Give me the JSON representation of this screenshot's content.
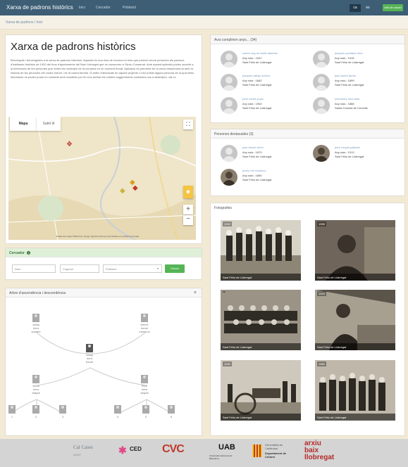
{
  "nav": {
    "brand": "Xarxa de padrons històrics",
    "links": [
      "Inici",
      "Cercador",
      "Població"
    ],
    "lang_active": "ca",
    "lang_other": "es",
    "signup": "Alta de usuari"
  },
  "breadcrumb": "Xarxa de padrons  /  Inici",
  "intro": {
    "title": "Xarxa de padrons històrics",
    "text": "Benvinguts i benvingudes a la xarxa de padrons històrics. Aquesta és una eina de recerca en línia que permet cercar persones als padrons d'habitants històrics de 1920 del fons d'ajuntaments del Baix Llobregat que es conserven a l'Arxiu Comarcal. Amb aquest aplicatiu podeu accedir a la informació de les persones que vivien els municipis de la comarca en un moment donat. Aplicació es permetrà fer la cerca relacionant-la amb la història de les persones del vostre entorn i de la vostra família. Si esteu interessats en aquest projecte o heu trobat alguna persona de la qual teniu informació us podeu posar en contacte amb nosaltres per fer-nos arribar els vostres suggeriments contacteu-nos a abaix@cc. cat.cc"
  },
  "map": {
    "tab_map": "Mapa",
    "tab_satellite": "Satèl·lit",
    "attribution": "Dades del mapa ©2020 Inst. Geogr. Nacional   Termes d'ús   Notifica un problema al mapa"
  },
  "search": {
    "title": "Cercador",
    "placeholders": [
      "Nom",
      "Cognom",
      "Població"
    ],
    "button": "Cercar"
  },
  "tree": {
    "title": "Arbre d'ascendència i descendència",
    "close": "×",
    "nodes": [
      {
        "label": "Josep\nriera\nsantaló"
      },
      {
        "label": "Mercè\nbonet\nmarimon"
      },
      {
        "label": "Josep\nriera\nbonet"
      },
      {
        "label": "Anna\nriera\nvilaplà"
      },
      {
        "label": "Pere\nriera\nvilaplà"
      }
    ],
    "children": [
      "1",
      "2",
      "3",
      "4",
      "5",
      "6"
    ]
  },
  "birthdays": {
    "title": "Avui complirien anys... (34)",
    "people": [
      {
        "name": "carles roig de batlle albertós",
        "year": "Any naix.: 1947",
        "place": "Sant Feliu de Llobregat"
      },
      {
        "name": "joaquim quintana riera",
        "year": "Any naix.: 1915",
        "place": "Sant Feliu de Llobregat"
      },
      {
        "name": "joaquim vallejo llorens",
        "year": "Any naix.: 1882",
        "place": "Sant Feliu de Llobregat"
      },
      {
        "name": "joan bonet farrés",
        "year": "Any naix.: 1899",
        "place": "Sant Feliu de Llobregat"
      },
      {
        "name": "pere cortés pujol",
        "year": "Any naix.: 1902",
        "place": "Sant Feliu de Llobregat"
      },
      {
        "name": "mercedes riera tintó",
        "year": "Any naix.: 1888",
        "place": "Santa Coloma de Cervelló"
      }
    ]
  },
  "notable": {
    "title": "Persones destacades (3)",
    "people": [
      {
        "name": "joan bosch ferrer",
        "year": "Any naix.: 1870",
        "place": "Sant Feliu de Llobregat"
      },
      {
        "name": "pere miquel pallarès",
        "year": "Any naix.: 1913",
        "place": "Sant Feliu de Llobregat"
      },
      {
        "name": "pedro mir martínez",
        "year": "Any naix.: 1890",
        "place": "Sant Feliu de Llobregat"
      }
    ]
  },
  "photos": {
    "title": "Fotografies",
    "items": [
      {
        "year": "1932",
        "place": "Sant Feliu de Llobregat"
      },
      {
        "year": "1955",
        "place": "Sant Feliu de Llobregat"
      },
      {
        "year": "",
        "place": "Sant Feliu de Llobregat"
      },
      {
        "year": "1944",
        "place": "Sant Feliu de Llobregat"
      },
      {
        "year": "1932",
        "place": "Sant Feliu de Llobregat"
      },
      {
        "year": "1960",
        "place": "Sant Feliu de Llobregat"
      }
    ]
  },
  "footer": {
    "logo1": "Cal Cases",
    "logo1_sub": "ACDF",
    "logo2": "CED",
    "logo3": "CVC",
    "logo4": "UAB",
    "logo4_sub": "Universitat Autònoma de Barcelona",
    "logo5": "Generalitat de Catalunya",
    "logo5_sub": "Departament de Cultura",
    "logo6": "arxiu\nbaix\nllobregat"
  },
  "colors": {
    "navbar": "#3d5e75",
    "accent_green": "#55b455",
    "link_blue": "#7a9ac0",
    "page_bg": "#f3ead6"
  }
}
